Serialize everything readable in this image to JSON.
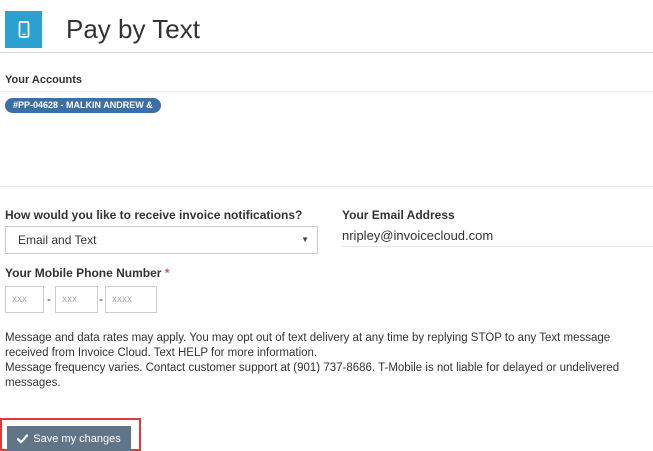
{
  "header": {
    "title": "Pay by Text",
    "icon": "mobile-phone-icon",
    "icon_bg_color": "#2aa1cf"
  },
  "accounts": {
    "label": "Your Accounts",
    "items": [
      {
        "label": "#PP-04628 - MALKIN ANDREW &"
      }
    ],
    "pill_color": "#3a6fa8"
  },
  "notifications": {
    "label": "How would you like to receive invoice notifications?",
    "selected": "Email and Text"
  },
  "email": {
    "label": "Your Email Address",
    "value": "nripley@invoicecloud.com"
  },
  "phone": {
    "label": "Your Mobile Phone Number",
    "required_marker": "*",
    "area_placeholder": "xxx",
    "prefix_placeholder": "xxx",
    "line_placeholder": "xxxx",
    "separator": "-"
  },
  "disclaimer": {
    "paragraph1": "Message and data rates may apply. You may opt out of text delivery at any time by replying STOP to any Text message received from Invoice Cloud. Text HELP for more information.",
    "paragraph2": "Message frequency varies. Contact customer support at (901) 737-8686. T-Mobile is not liable for delayed or undelivered messages."
  },
  "actions": {
    "save_label": "Save my changes",
    "save_icon": "checkmark-icon",
    "save_color": "#607587",
    "highlight_color": "#e03a3a"
  }
}
